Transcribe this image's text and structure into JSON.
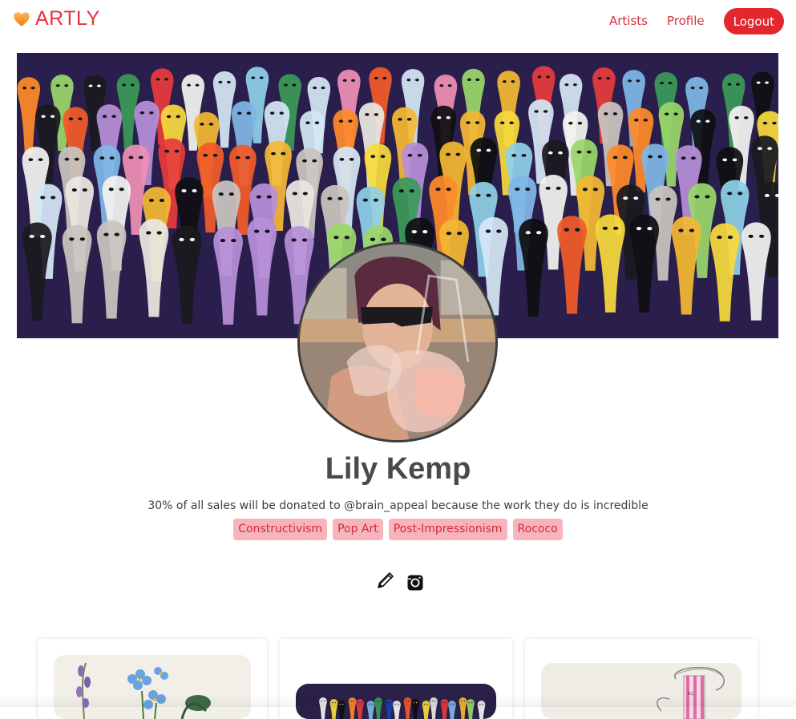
{
  "nav": {
    "logo_text": "ARTLY",
    "links": [
      {
        "label": "Artists"
      },
      {
        "label": "Profile"
      }
    ],
    "logout_label": "Logout"
  },
  "colors": {
    "brand": "#e8323c",
    "logout_bg": "#e4262f",
    "tag_bg": "#f8b4bd",
    "tag_text": "#d22a3b"
  },
  "profile": {
    "name": "Lily Kemp",
    "bio": "30% of all sales will be donated to @brain_appeal because the work they do is incredible",
    "tags": [
      "Constructivism",
      "Pop Art",
      "Post-Impressionism",
      "Rococo"
    ],
    "action_icons": [
      "pencil-icon",
      "instagram-icon"
    ]
  }
}
